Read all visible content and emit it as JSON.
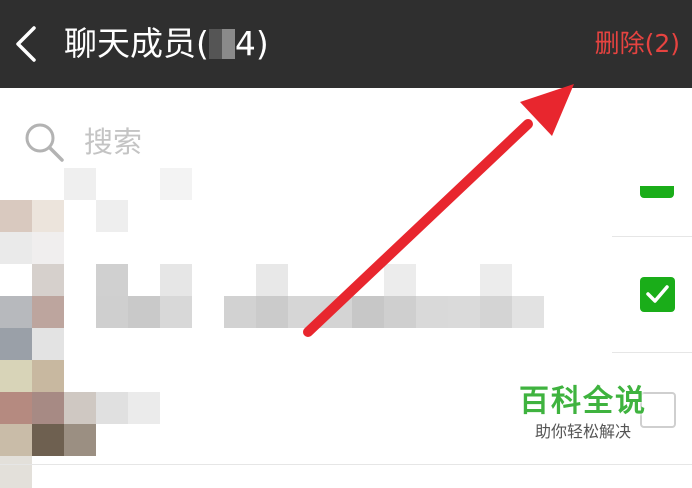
{
  "header": {
    "back_icon": "chevron-left-icon",
    "title": "聊天成员(",
    "title_suffix": "4)",
    "delete_label": "删除(2)",
    "delete_color": "#e64340",
    "bar_color": "#2f2f2f"
  },
  "search": {
    "icon": "search-icon",
    "placeholder": "搜索"
  },
  "members": {
    "checkbox_states": [
      "checked",
      "checked",
      "unchecked"
    ],
    "check_color": "#1aad19"
  },
  "watermark": {
    "title": "百科全说",
    "subtitle": "助你轻松解决"
  },
  "annotation": {
    "arrow_color": "#e8262e",
    "points_to": "delete-button"
  }
}
